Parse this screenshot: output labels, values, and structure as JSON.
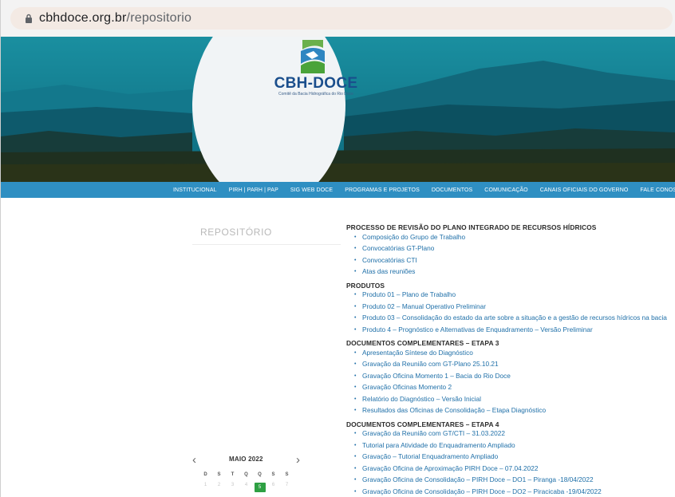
{
  "browser": {
    "url_domain": "cbhdoce.org.br",
    "url_path": "/repositorio"
  },
  "logo": {
    "name": "CBH-DOCE",
    "subtitle": "Comitê da Bacia Hidrográfica do Rio Doce"
  },
  "nav": [
    "INSTITUCIONAL",
    "PIRH | PARH | PAP",
    "SIG WEB DOCE",
    "PROGRAMAS E PROJETOS",
    "DOCUMENTOS",
    "COMUNICAÇÃO",
    "CANAIS OFICIAIS DO GOVERNO",
    "FALE CONOSCO"
  ],
  "sidebar": {
    "title": "REPOSITÓRIO"
  },
  "calendar": {
    "prev": "‹",
    "next": "›",
    "title": "MAIO 2022",
    "weekdays": [
      "D",
      "S",
      "T",
      "Q",
      "Q",
      "S",
      "S"
    ],
    "days": [
      "1",
      "2",
      "3",
      "4",
      "5",
      "6",
      "7"
    ],
    "selected_day": "5"
  },
  "content": {
    "sections": [
      {
        "title": "PROCESSO DE REVISÃO DO PLANO INTEGRADO DE RECURSOS HÍDRICOS",
        "items": [
          "Composição do Grupo de Trabalho",
          "Convocatórias GT-Plano",
          "Convocatórias CTI",
          "Atas das reuniões"
        ]
      },
      {
        "title": "PRODUTOS",
        "items": [
          "Produto 01 – Plano de Trabalho",
          "Produto 02 – Manual Operativo Preliminar",
          "Produto 03 – Consolidação do estado da arte sobre a situação e a gestão de recursos hídricos na bacia",
          "Produto 4 – Prognóstico e Alternativas de Enquadramento – Versão Preliminar"
        ]
      },
      {
        "title": "DOCUMENTOS COMPLEMENTARES – ETAPA 3",
        "items": [
          "Apresentação Síntese do Diagnóstico",
          "Gravação da Reunião com GT-Plano 25.10.21",
          "Gravação Oficina Momento 1 – Bacia do Rio Doce",
          "Gravação Oficinas Momento 2",
          "Relatório do Diagnóstico – Versão Inicial",
          "Resultados das Oficinas de Consolidação – Etapa Diagnóstico"
        ]
      },
      {
        "title": "DOCUMENTOS COMPLEMENTARES – ETAPA 4",
        "items": [
          "Gravação da Reunião com GT/CTI – 31.03.2022",
          "Tutorial para Atividade do Enquadramento Ampliado",
          "Gravação – Tutorial Enquadramento Ampliado",
          "Gravação Oficina de Aproximação PIRH Doce – 07.04.2022",
          "Gravação Oficina de Consolidação – PIRH Doce – DO1 – Piranga -18/04/2022",
          "Gravação Oficina de Consolidação – PIRH Doce – DO2 – Piracicaba -19/04/2022"
        ]
      }
    ]
  },
  "colors": {
    "nav": "#2f8fc2",
    "link": "#1e6fa8",
    "today": "#2ea043",
    "hero": "#0f6f84"
  }
}
